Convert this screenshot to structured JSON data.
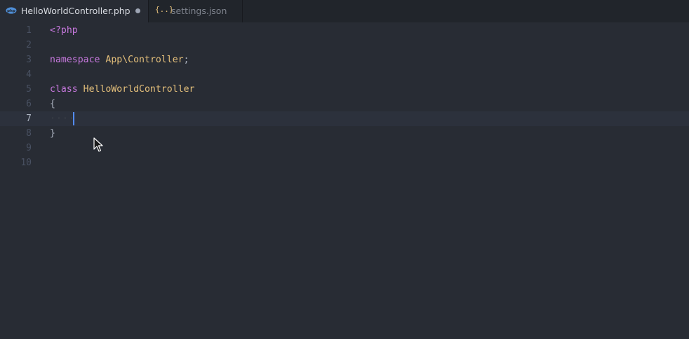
{
  "tabs": [
    {
      "title": "HelloWorldController.php",
      "icon": "php-file-icon",
      "active": true,
      "modified": true
    },
    {
      "title": "settings.json",
      "icon": "json-braces-icon",
      "icon_glyph": "{..}",
      "active": false,
      "modified": false
    }
  ],
  "editor": {
    "current_line": 7,
    "line_numbers": [
      "1",
      "2",
      "3",
      "4",
      "5",
      "6",
      "7",
      "8",
      "9",
      "10"
    ],
    "lines": {
      "l1_open_tag": "<?php",
      "l3_keyword": "namespace",
      "l3_name": "App\\Controller",
      "l3_semicolon": ";",
      "l5_keyword": "class",
      "l5_name": "HelloWorldController",
      "l6_brace": "{",
      "l7_indent": "····",
      "l8_brace": "}"
    }
  },
  "colors": {
    "background": "#282c34",
    "tabbar": "#21252b",
    "keyword": "#c678dd",
    "type": "#e5c07b",
    "text": "#abb2bf",
    "cursor": "#528bff"
  }
}
